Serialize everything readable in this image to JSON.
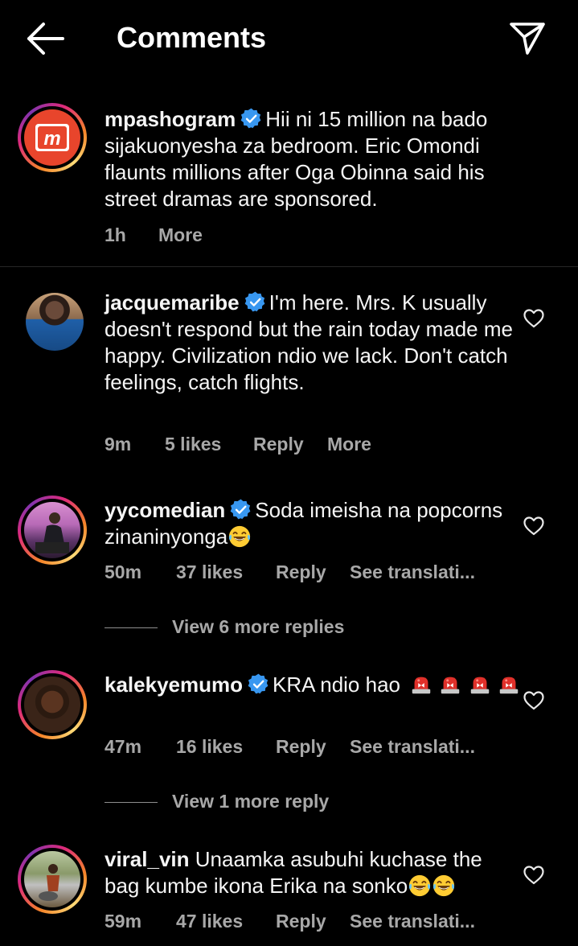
{
  "header": {
    "title": "Comments",
    "back_icon": "arrow-left-icon",
    "share_icon": "paper-plane-icon"
  },
  "caption": {
    "username": "mpashogram",
    "verified": true,
    "text": "Hii ni 15 million na bado sijakuonyesha za bedroom. Eric Omondi flaunts millions after Oga Obinna said his street dramas are sponsored.",
    "time": "1h",
    "more": "More",
    "avatar_letter": "m"
  },
  "comments": [
    {
      "username": "jacquemaribe",
      "verified": true,
      "text": "I'm here. Mrs. K usually doesn't respond but the rain today made me happy. Civilization ndio we lack. Don't catch feelings, catch flights.",
      "time": "9m",
      "likes": "5 likes",
      "reply": "Reply",
      "extra": "More"
    },
    {
      "username": "yycomedian",
      "verified": true,
      "text": "Soda imeisha na popcorns zinaninyonga",
      "time": "50m",
      "likes": "37 likes",
      "reply": "Reply",
      "extra": "See translati...",
      "view_more": "View 6 more replies"
    },
    {
      "username": "kalekyemumo",
      "verified": true,
      "text": "KRA ndio hao",
      "time": "47m",
      "likes": "16 likes",
      "reply": "Reply",
      "extra": "See translati...",
      "view_more": "View 1 more reply"
    },
    {
      "username": "viral_vin",
      "verified": false,
      "text": "Unaamka asubuhi kuchase the bag kumbe ikona Erika na sonko",
      "time": "59m",
      "likes": "47 likes",
      "reply": "Reply",
      "extra": "See translati..."
    }
  ],
  "colors": {
    "background": "#000000",
    "text": "#f5f5f5",
    "secondary": "#a8a8a8",
    "verified": "#3897f0",
    "mpasho_red": "#e8452c"
  }
}
